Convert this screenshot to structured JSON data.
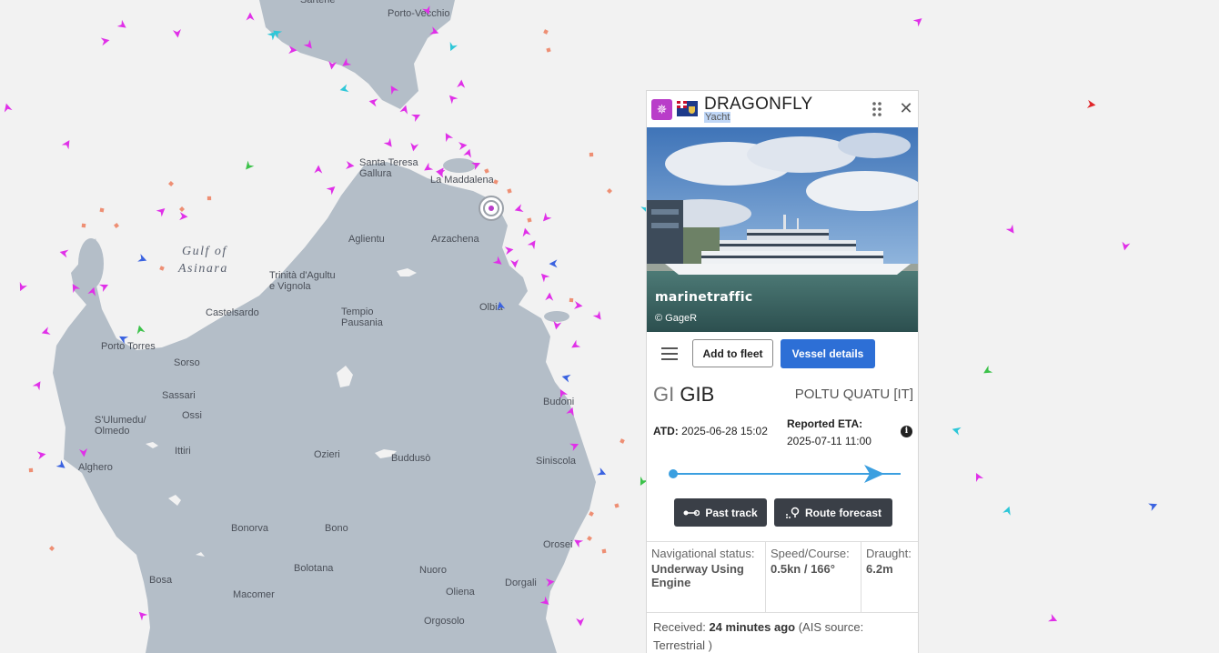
{
  "map": {
    "places": [
      {
        "id": "sartene",
        "name": "Sartène"
      },
      {
        "id": "porto-vecchio",
        "name": "Porto-Vecchio"
      },
      {
        "id": "santa-teresa",
        "name": "Santa Teresa\nGallura"
      },
      {
        "id": "la-maddalena",
        "name": "La Maddalena"
      },
      {
        "id": "aglientu",
        "name": "Aglientu"
      },
      {
        "id": "arzachena",
        "name": "Arzachena"
      },
      {
        "id": "trinita",
        "name": "Trinità d'Agultu\ne Vignola"
      },
      {
        "id": "castelsardo",
        "name": "Castelsardo"
      },
      {
        "id": "tempio",
        "name": "Tempio\nPausania"
      },
      {
        "id": "olbia",
        "name": "Olbia"
      },
      {
        "id": "porto-torres",
        "name": "Porto Torres"
      },
      {
        "id": "sorso",
        "name": "Sorso"
      },
      {
        "id": "sassari",
        "name": "Sassari"
      },
      {
        "id": "budoni",
        "name": "Budoni"
      },
      {
        "id": "sulumedu",
        "name": "S'Ulumedu/\nOlmedo"
      },
      {
        "id": "ossi",
        "name": "Ossi"
      },
      {
        "id": "ozieri",
        "name": "Ozieri"
      },
      {
        "id": "buddoso",
        "name": "Buddusò"
      },
      {
        "id": "ittiri",
        "name": "Ittiri"
      },
      {
        "id": "siniscola",
        "name": "Siniscola"
      },
      {
        "id": "alghero",
        "name": "Alghero"
      },
      {
        "id": "bonorva",
        "name": "Bonorva"
      },
      {
        "id": "bono",
        "name": "Bono"
      },
      {
        "id": "orosei",
        "name": "Orosei"
      },
      {
        "id": "bosa",
        "name": "Bosa"
      },
      {
        "id": "bolotana",
        "name": "Bolotana"
      },
      {
        "id": "nuoro",
        "name": "Nuoro"
      },
      {
        "id": "dorgali",
        "name": "Dorgali"
      },
      {
        "id": "macomer",
        "name": "Macomer"
      },
      {
        "id": "oliena",
        "name": "Oliena"
      },
      {
        "id": "orgosolo",
        "name": "Orgosolo"
      }
    ],
    "gulf_line1": "Gulf of",
    "gulf_line2": "Asinara"
  },
  "vessel": {
    "name": "DRAGONFLY",
    "type": "Yacht",
    "type_icon": "yacht-wheel-icon",
    "flag_icon": "cayman-islands-flag-icon",
    "photo_watermark": "marinetraffic",
    "photo_credit": "© GageR",
    "actions": {
      "add_fleet": "Add to fleet",
      "details": "Vessel details"
    },
    "flag_code": "GI",
    "port_code": "GIB",
    "destination": "POLTU QUATU [IT]",
    "atd_label": "ATD:",
    "atd_value": "2025-06-28 15:02",
    "eta_label": "Reported ETA:",
    "eta_value": "2025-07-11 11:00",
    "route_progress": 0.88,
    "past_track": "Past track",
    "route_forecast": "Route forecast",
    "nav_status_label": "Navigational status:",
    "nav_status_value": "Underway Using Engine",
    "speed_label": "Speed/Course:",
    "speed_value": "0.5kn / 166°",
    "draught_label": "Draught:",
    "draught_value": "6.2m",
    "received_label": "Received:",
    "received_value": "24 minutes ago",
    "ais_source_pre": "(AIS source:",
    "ais_source_value": "Terrestrial )"
  },
  "colors": {
    "sea": "#f2f2f2",
    "land": "#b4bec8",
    "accent": "#2d6fd6",
    "yacht": "#e030e8",
    "route": "#3b9fe0"
  }
}
